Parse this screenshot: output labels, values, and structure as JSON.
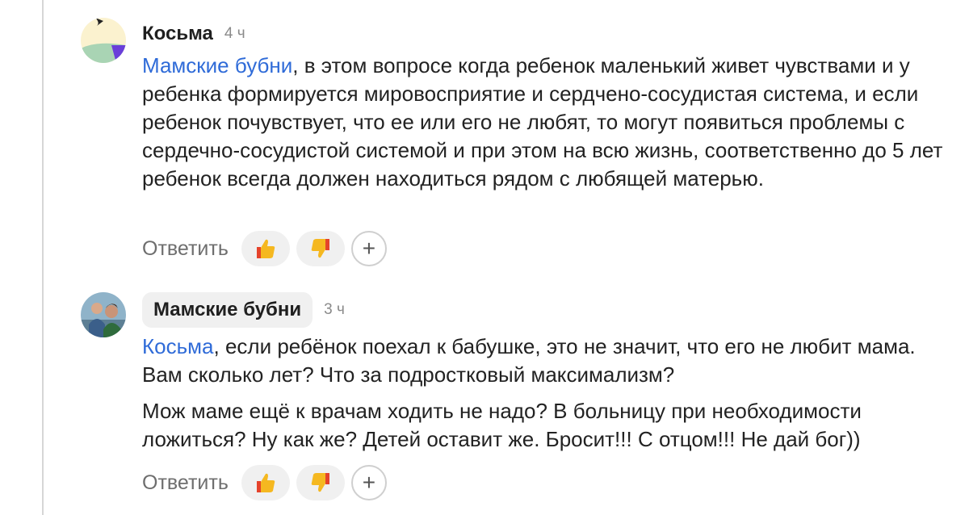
{
  "comments": [
    {
      "author": "Косьма",
      "time": "4 ч",
      "mention": "Мамские бубни",
      "paragraphs": [
        ", в этом вопросе когда ребенок маленький живет чувствами и у ребенка формируется мировосприятие и сердчено-сосудистая система, и если ребенок почувствует, что ее или его не любят, то могут появиться проблемы с сердечно-сосудистой системой и при этом на всю жизнь, соответственно до 5 лет ребенок всегда должен находиться рядом с любящей матерью."
      ],
      "reply_label": "Ответить",
      "add_reaction_label": "+"
    },
    {
      "author": "Мамские бубни",
      "time": "3 ч",
      "mention": "Косьма",
      "paragraphs": [
        ", если ребёнок поехал к бабушке, это не значит, что его не любит мама. Вам сколько лет? Что за подростковый максимализм?",
        "Мож маме ещё к врачам ходить не надо? В больницу при необходимости ложиться? Ну как же? Детей оставит же. Бросит!!! С отцом!!! Не дай бог))"
      ],
      "reply_label": "Ответить",
      "add_reaction_label": "+"
    }
  ],
  "icons": {
    "like": "thumbs-up-icon",
    "dislike": "thumbs-down-icon"
  },
  "colors": {
    "mention": "#2f6bd8",
    "thumb_yellow": "#f5b820",
    "thumb_red": "#e5432b"
  }
}
